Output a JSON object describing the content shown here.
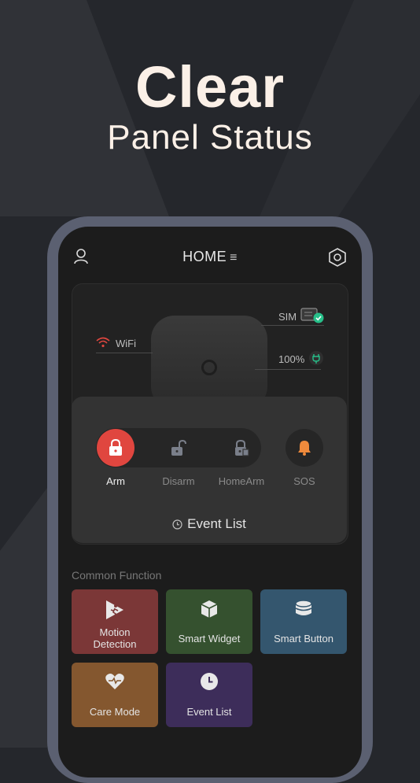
{
  "headline": {
    "title": "Clear",
    "subtitle": "Panel Status"
  },
  "topbar": {
    "title": "HOME",
    "menu_glyph": "≡"
  },
  "status": {
    "wifi_label": "WiFi",
    "sim_label": "SIM",
    "battery_label": "100%"
  },
  "controls": [
    {
      "label": "Arm",
      "icon": "lock-icon",
      "active": true
    },
    {
      "label": "Disarm",
      "icon": "unlock-icon",
      "active": false
    },
    {
      "label": "HomeArm",
      "icon": "home-arm-icon",
      "active": false
    },
    {
      "label": "SOS",
      "icon": "bell-icon",
      "active": false
    }
  ],
  "event_list_label": "Event List",
  "common": {
    "title": "Common Function",
    "tiles": [
      {
        "label": "Motion Detection",
        "icon": "motion-icon",
        "color": "#7b3737"
      },
      {
        "label": "Smart Widget",
        "icon": "cube-icon",
        "color": "#35512f"
      },
      {
        "label": "Smart Button",
        "icon": "database-icon",
        "color": "#34566e"
      },
      {
        "label": "Care Mode",
        "icon": "heart-icon",
        "color": "#84572f"
      },
      {
        "label": "Event List",
        "icon": "clock-icon",
        "color": "#3d2d5a"
      }
    ]
  },
  "colors": {
    "accent_red": "#e0463f",
    "sos_orange": "#ef8a3c",
    "wifi_red": "#e0463f",
    "ok_green": "#27c08a"
  }
}
